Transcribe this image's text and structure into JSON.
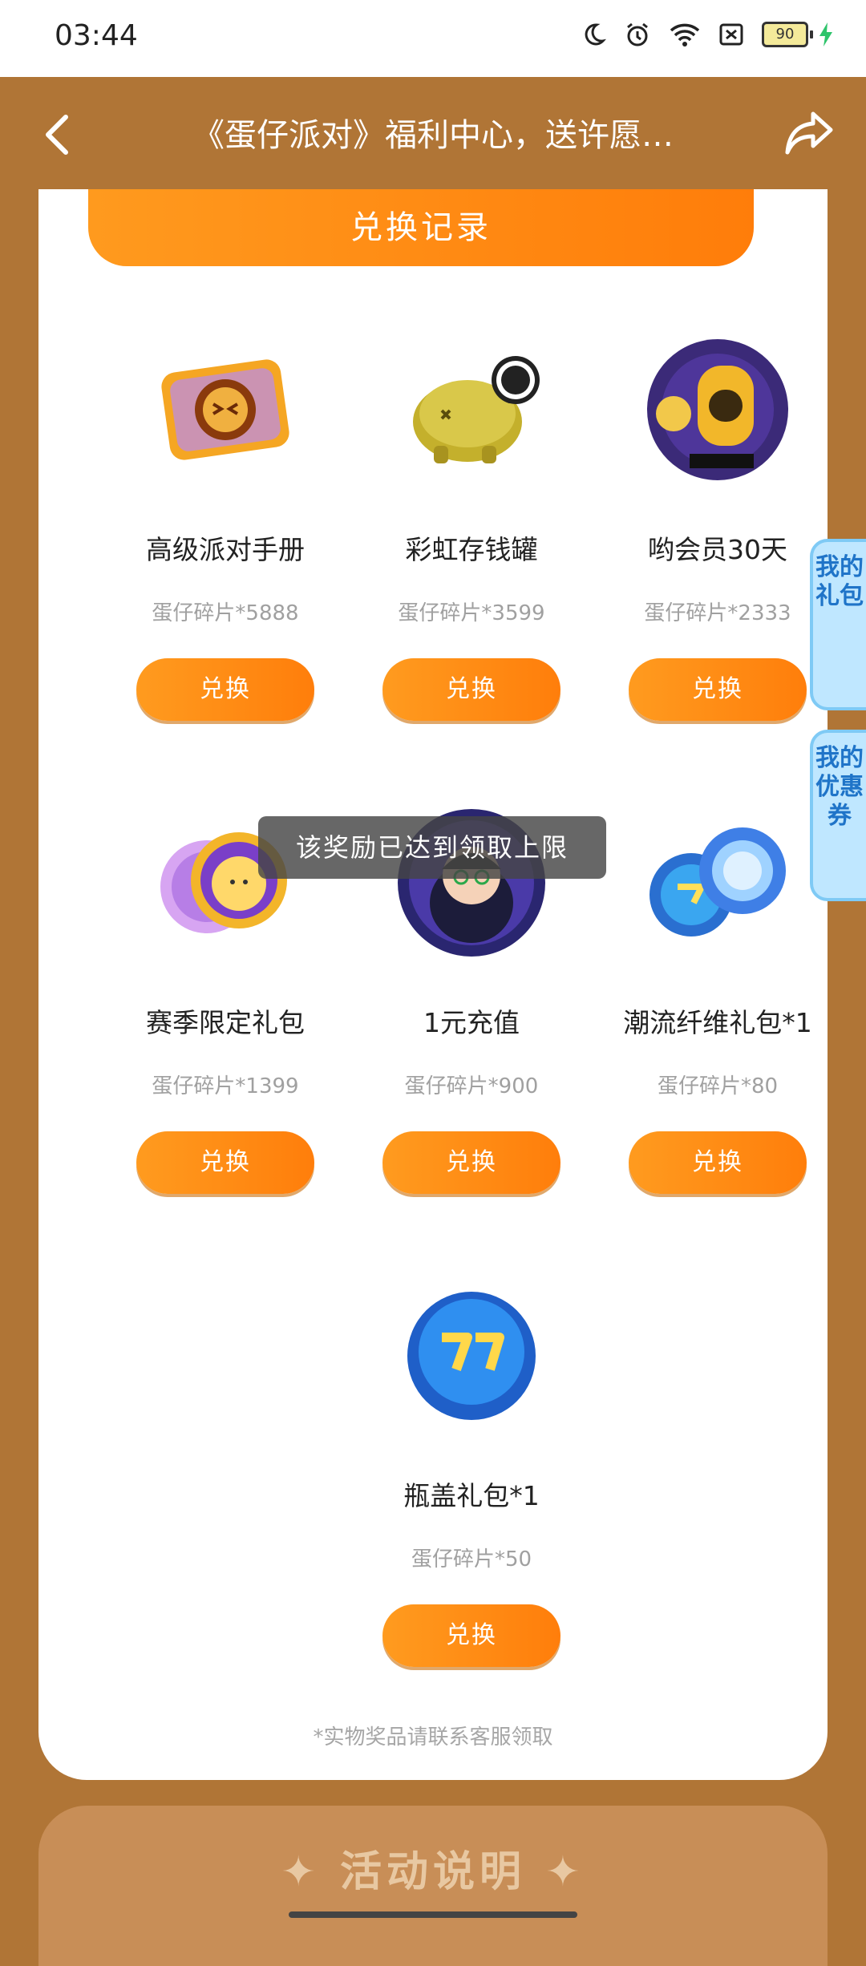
{
  "status_bar": {
    "time": "03:44",
    "battery": "90"
  },
  "header": {
    "title": "《蛋仔派对》福利中心，送许愿…"
  },
  "record_button": "兑换记录",
  "items": [
    {
      "name": "高级派对手册",
      "price": "蛋仔碎片*5888",
      "button": "兑换"
    },
    {
      "name": "彩虹存钱罐",
      "price": "蛋仔碎片*3599",
      "button": "兑换"
    },
    {
      "name": "哟会员30天",
      "price": "蛋仔碎片*2333",
      "button": "兑换"
    },
    {
      "name": "赛季限定礼包",
      "price": "蛋仔碎片*1399",
      "button": "兑换"
    },
    {
      "name": "1元充值",
      "price": "蛋仔碎片*900",
      "button": "兑换"
    },
    {
      "name": "潮流纤维礼包*1",
      "price": "蛋仔碎片*80",
      "button": "兑换"
    },
    {
      "name": "瓶盖礼包*1",
      "price": "蛋仔碎片*50",
      "button": "兑换"
    }
  ],
  "note": "*实物奖品请联系客服领取",
  "toast": "该奖励已达到领取上限",
  "side_tabs": {
    "gift": "我的礼包",
    "coupon": "我的优惠券"
  },
  "bottom_panel": {
    "title": "✦ 活动说明 ✦"
  },
  "colors": {
    "accent": "#ff8a12",
    "background": "#b07536",
    "side_tab": "#bfe7ff"
  }
}
